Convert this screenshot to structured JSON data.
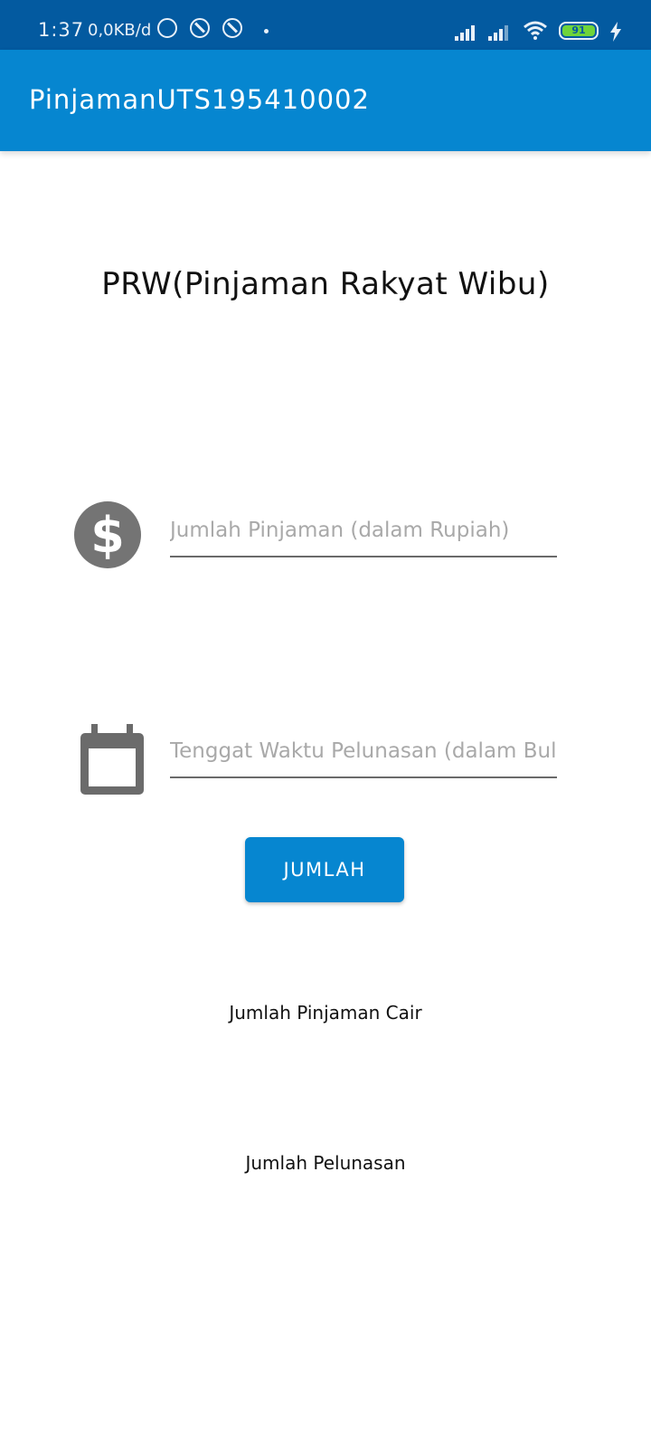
{
  "status_bar": {
    "time": "1:37",
    "speed": "0,0KB/d",
    "battery_level": "91",
    "background_color": "#035aa0",
    "icons": [
      "whatsapp-icon",
      "notification-ring-icon",
      "notification-ring-icon",
      "dot-icon",
      "signal-icon",
      "signal-icon",
      "wifi-icon",
      "battery-icon",
      "charging-icon"
    ]
  },
  "app_bar": {
    "title": "PinjamanUTS195410002",
    "color": "#0686d0"
  },
  "main": {
    "heading": "PRW(Pinjaman Rakyat Wibu)",
    "loan_field": {
      "icon": "dollar-icon",
      "placeholder": "Jumlah Pinjaman (dalam Rupiah)",
      "value": ""
    },
    "term_field": {
      "icon": "calendar-icon",
      "placeholder": "Tenggat Waktu Pelunasan (dalam Bulan)",
      "value": ""
    },
    "button_label": "JUMLAH",
    "result_cair_label": "Jumlah Pinjaman Cair",
    "result_pelunasan_label": "Jumlah Pelunasan"
  }
}
